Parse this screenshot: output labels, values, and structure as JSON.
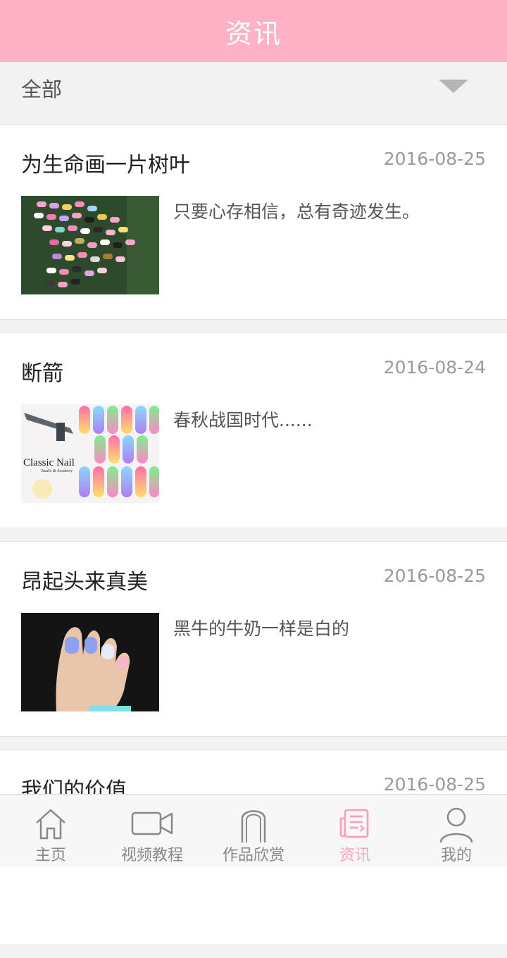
{
  "header": {
    "title": "资讯"
  },
  "filter": {
    "selected": "全部"
  },
  "news": [
    {
      "title": "为生命画一片树叶",
      "date": "2016-08-25",
      "summary": "只要心存相信，总有奇迹发生。",
      "thumb": "nails-colorful-collection"
    },
    {
      "title": "断箭",
      "date": "2016-08-24",
      "summary": "春秋战国时代......",
      "thumb": "classic-nail-airbrush",
      "thumb_text": "Classic Nail",
      "thumb_subtext": "Studio & Academy"
    },
    {
      "title": "昂起头来真美",
      "date": "2016-08-25",
      "summary": "黑牛的牛奶一样是白的",
      "thumb": "hand-manicure"
    },
    {
      "title": "我们的价值",
      "date": "2016-08-25",
      "summary": "",
      "thumb": ""
    }
  ],
  "tabs": [
    {
      "label": "主页",
      "icon": "home-icon",
      "active": false
    },
    {
      "label": "视频教程",
      "icon": "video-camera-icon",
      "active": false
    },
    {
      "label": "作品欣赏",
      "icon": "nail-icon",
      "active": false
    },
    {
      "label": "资讯",
      "icon": "newspaper-icon",
      "active": true
    },
    {
      "label": "我的",
      "icon": "user-icon",
      "active": false
    }
  ],
  "colors": {
    "accent": "#ffb1c6",
    "active_tab": "#f4a3bb",
    "inactive_tab": "#888888"
  }
}
